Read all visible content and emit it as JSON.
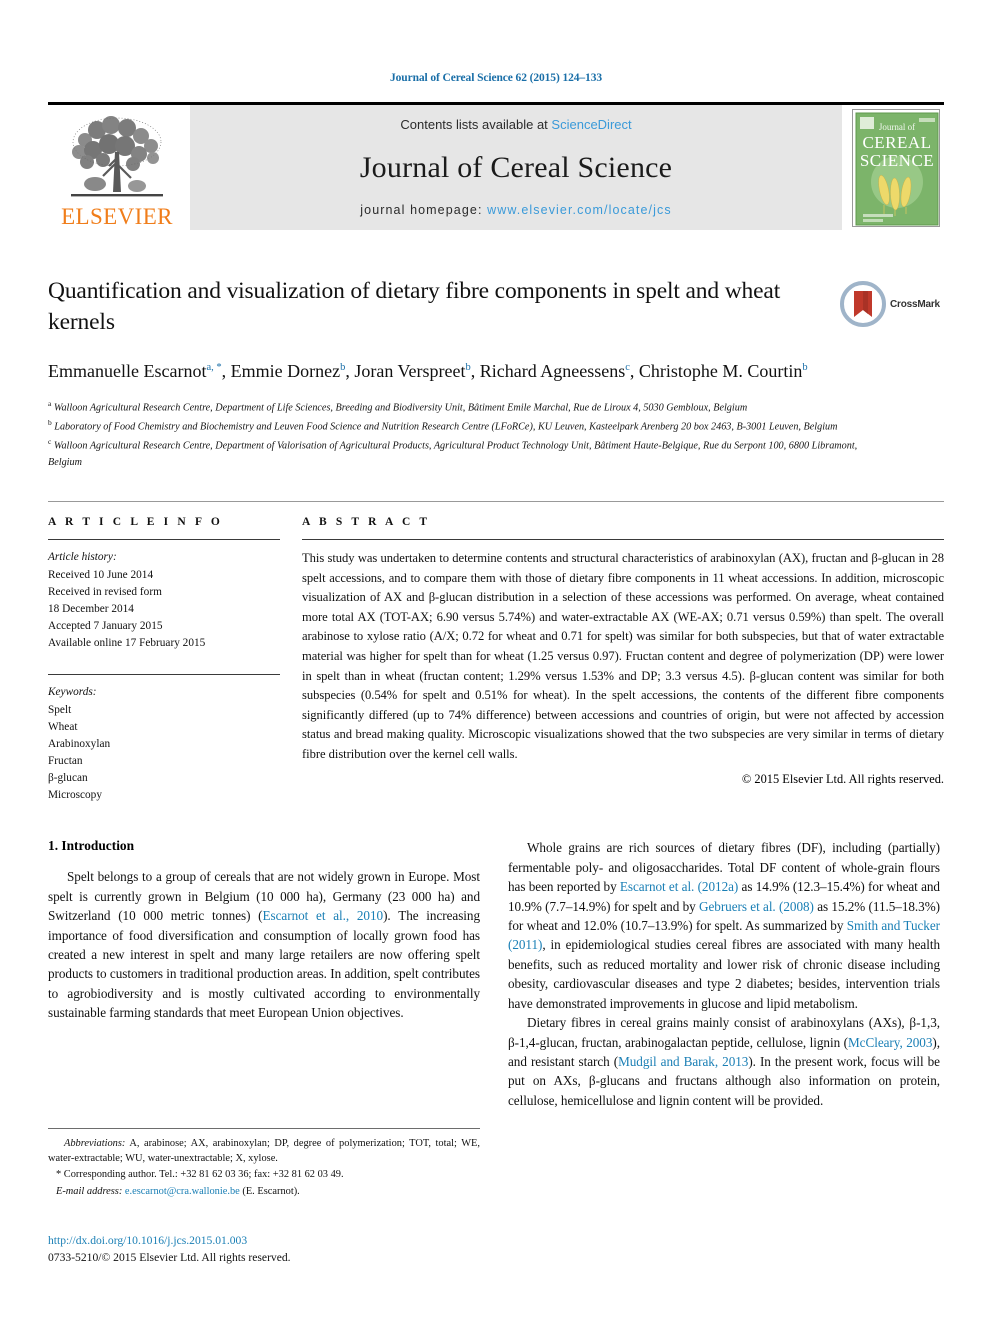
{
  "running_head": "Journal of Cereal Science 62 (2015) 124–133",
  "masthead": {
    "elsevier_wordmark": "ELSEVIER",
    "contents_prefix": "Contents lists available at",
    "sciencedirect": "ScienceDirect",
    "journal_title": "Journal of Cereal Science",
    "homepage_label": "journal homepage:",
    "homepage_url": "www.elsevier.com/locate/jcs",
    "cover_line1": "Journal of",
    "cover_line2": "CEREAL",
    "cover_line3": "SCIENCE"
  },
  "article": {
    "title": "Quantification and visualization of dietary fibre components in spelt and wheat kernels",
    "crossmark_label": "CrossMark",
    "authors": [
      {
        "name": "Emmanuelle Escarnot",
        "marks": "a, *"
      },
      {
        "name": "Emmie Dornez",
        "marks": "b"
      },
      {
        "name": "Joran Verspreet",
        "marks": "b"
      },
      {
        "name": "Richard Agneessens",
        "marks": "c"
      },
      {
        "name": "Christophe M. Courtin",
        "marks": "b"
      }
    ],
    "affiliations": [
      {
        "mark": "a",
        "text": "Walloon Agricultural Research Centre, Department of Life Sciences, Breeding and Biodiversity Unit, Bâtiment Emile Marchal, Rue de Liroux 4, 5030 Gembloux, Belgium"
      },
      {
        "mark": "b",
        "text": "Laboratory of Food Chemistry and Biochemistry and Leuven Food Science and Nutrition Research Centre (LFoRCe), KU Leuven, Kasteelpark Arenberg 20 box 2463, B-3001 Leuven, Belgium"
      },
      {
        "mark": "c",
        "text": "Walloon Agricultural Research Centre, Department of Valorisation of Agricultural Products, Agricultural Product Technology Unit, Bâtiment Haute-Belgique, Rue du Serpont 100, 6800 Libramont, Belgium"
      }
    ]
  },
  "article_info": {
    "heading": "A R T I C L E   I N F O",
    "history_label": "Article history:",
    "history": [
      "Received 10 June 2014",
      "Received in revised form",
      "18 December 2014",
      "Accepted 7 January 2015",
      "Available online 17 February 2015"
    ],
    "keywords_label": "Keywords:",
    "keywords": [
      "Spelt",
      "Wheat",
      "Arabinoxylan",
      "Fructan",
      "β-glucan",
      "Microscopy"
    ]
  },
  "abstract": {
    "heading": "A B S T R A C T",
    "text": "This study was undertaken to determine contents and structural characteristics of arabinoxylan (AX), fructan and β-glucan in 28 spelt accessions, and to compare them with those of dietary fibre components in 11 wheat accessions. In addition, microscopic visualization of AX and β-glucan distribution in a selection of these accessions was performed. On average, wheat contained more total AX (TOT-AX; 6.90 versus 5.74%) and water-extractable AX (WE-AX; 0.71 versus 0.59%) than spelt. The overall arabinose to xylose ratio (A/X; 0.72 for wheat and 0.71 for spelt) was similar for both subspecies, but that of water extractable material was higher for spelt than for wheat (1.25 versus 0.97). Fructan content and degree of polymerization (DP) were lower in spelt than in wheat (fructan content; 1.29% versus 1.53% and DP; 3.3 versus 4.5). β-glucan content was similar for both subspecies (0.54% for spelt and 0.51% for wheat). In the spelt accessions, the contents of the different fibre components significantly differed (up to 74% difference) between accessions and countries of origin, but were not affected by accession status and bread making quality. Microscopic visualizations showed that the two subspecies are very similar in terms of dietary fibre distribution over the kernel cell walls.",
    "copyright": "© 2015 Elsevier Ltd. All rights reserved."
  },
  "body": {
    "section_heading": "1.  Introduction",
    "left_paragraph_1_part1": "Spelt belongs to a group of cereals that are not widely grown in Europe. Most spelt is currently grown in Belgium (10 000 ha), Germany (23 000 ha) and Switzerland (10 000 metric tonnes) (",
    "left_cite_1": "Escarnot et al., 2010",
    "left_paragraph_1_part2": "). The increasing importance of food diversification and consumption of locally grown food has created a new interest in spelt and many large retailers are now offering spelt products to customers in traditional production areas. In addition, spelt contributes to agrobiodiversity and is mostly cultivated according to environmentally sustainable farming standards that meet European Union objectives.",
    "right_paragraph_1_part1": "Whole grains are rich sources of dietary fibres (DF), including (partially) fermentable poly- and oligosaccharides. Total DF content of whole-grain flours has been reported by ",
    "right_cite_1": "Escarnot et al. (2012a)",
    "right_paragraph_1_part2": " as 14.9% (12.3–15.4%) for wheat and 10.9% (7.7–14.9%) for spelt and by ",
    "right_cite_2": "Gebruers et al. (2008)",
    "right_paragraph_1_part3": " as 15.2% (11.5–18.3%) for wheat and 12.0% (10.7–13.9%) for spelt. As summarized by ",
    "right_cite_3": "Smith and Tucker (2011)",
    "right_paragraph_1_part4": ", in epidemiological studies cereal fibres are associated with many health benefits, such as reduced mortality and lower risk of chronic disease including obesity, cardiovascular diseases and type 2 diabetes; besides, intervention trials have demonstrated improvements in glucose and lipid metabolism.",
    "right_paragraph_2_part1": "Dietary fibres in cereal grains mainly consist of arabinoxylans (AXs), β-1,3, β-1,4-glucan, fructan, arabinogalactan peptide, cellulose, lignin (",
    "right_cite_4": "McCleary, 2003",
    "right_paragraph_2_part2": "), and resistant starch (",
    "right_cite_5": "Mudgil and Barak, 2013",
    "right_paragraph_2_part3": "). In the present work, focus will be put on AXs, β-glucans and fructans although also information on protein, cellulose, hemicellulose and lignin content will be provided."
  },
  "footnotes": {
    "abbrev_label": "Abbreviations:",
    "abbrev_text": " A, arabinose; AX, arabinoxylan; DP, degree of polymerization; TOT, total; WE, water-extractable; WU, water-unextractable; X, xylose.",
    "corresponding_marker": "*",
    "corresponding_text": " Corresponding author. Tel.: +32 81 62 03 36; fax: +32 81 62 03 49.",
    "email_label": "E-mail address:",
    "email": "e.escarnot@cra.wallonie.be",
    "email_owner": " (E. Escarnot)."
  },
  "footer": {
    "doi": "http://dx.doi.org/10.1016/j.jcs.2015.01.003",
    "issn_line": "0733-5210/© 2015 Elsevier Ltd. All rights reserved."
  },
  "colors": {
    "link_blue": "#1a7fb5",
    "sciencedirect_blue": "#3a9ad9",
    "elsevier_orange": "#f07d1a",
    "banner_gray": "#e6e6e6",
    "cover_green": "#6aa84f"
  }
}
